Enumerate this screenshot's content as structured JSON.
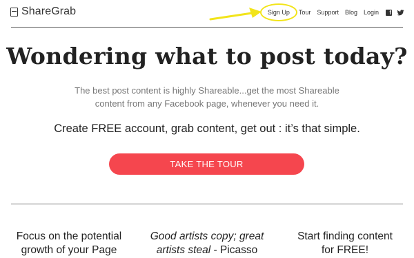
{
  "brand": {
    "name": "ShareGrab"
  },
  "nav": {
    "signup": "Sign Up",
    "tour": "Tour",
    "support": "Support",
    "blog": "Blog",
    "login": "Login",
    "facebook_icon": "facebook-icon",
    "twitter_icon": "twitter-icon"
  },
  "hero": {
    "headline": "Wondering what to post today?",
    "subtext_line1": "The best post content is highly Shareable...get the most Shareable",
    "subtext_line2": "content from any Facebook page, whenever you need it.",
    "tagline": "Create FREE account, grab content, get out : it’s that simple.",
    "cta_label": "TAKE THE TOUR"
  },
  "features": {
    "f1_line1": "Focus on the potential",
    "f1_line2": "growth of your Page",
    "f2_line1": "Good artists copy; great",
    "f2_line2_italic": "artists steal",
    "f2_line2_rest": " - Picasso",
    "f3_line1": "Start finding content",
    "f3_line2": "for FREE!"
  },
  "colors": {
    "cta": "#f5464e",
    "highlight": "#f2e41a",
    "text": "#222222",
    "muted": "#777777"
  }
}
